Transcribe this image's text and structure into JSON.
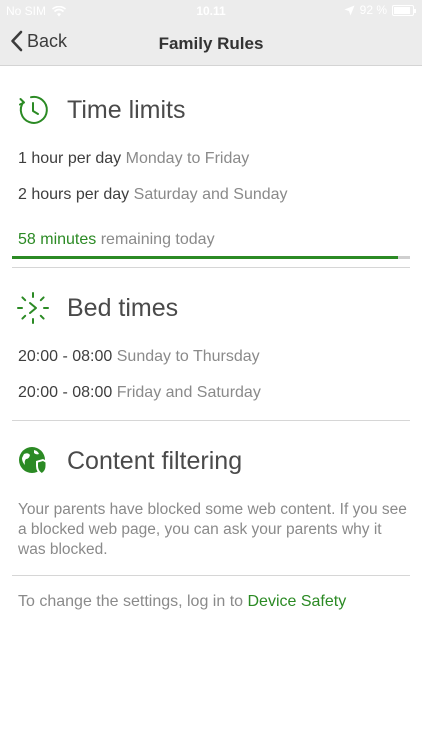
{
  "status_bar": {
    "carrier": "No SIM",
    "time": "10.11",
    "battery": "92 %",
    "battery_level": 0.92
  },
  "nav": {
    "back_label": "Back",
    "title": "Family Rules"
  },
  "time_limits": {
    "title": "Time limits",
    "rules": [
      {
        "value": "1 hour per day",
        "days": "Monday to Friday"
      },
      {
        "value": "2 hours per day",
        "days": "Saturday and Sunday"
      }
    ],
    "remaining_value": "58 minutes",
    "remaining_suffix": "remaining today",
    "progress_fraction": 0.97
  },
  "bed_times": {
    "title": "Bed times",
    "rules": [
      {
        "value": "20:00 - 08:00",
        "days": "Sunday to Thursday"
      },
      {
        "value": "20:00 - 08:00",
        "days": "Friday and Saturday"
      }
    ]
  },
  "content_filtering": {
    "title": "Content filtering",
    "description": "Your parents have blocked some web content. If you see a blocked web page, you can ask your parents why it was blocked."
  },
  "footer": {
    "text": "To change the settings, log in to",
    "link": "Device Safety"
  },
  "colors": {
    "accent": "#2b8a24",
    "muted_text": "#8a8a8a",
    "nav_background": "#ececec"
  },
  "icons": {
    "back": "chevron-left-icon",
    "time_limits": "clock-icon",
    "bed_times": "bedtime-icon",
    "content_filtering": "globe-shield-icon"
  }
}
